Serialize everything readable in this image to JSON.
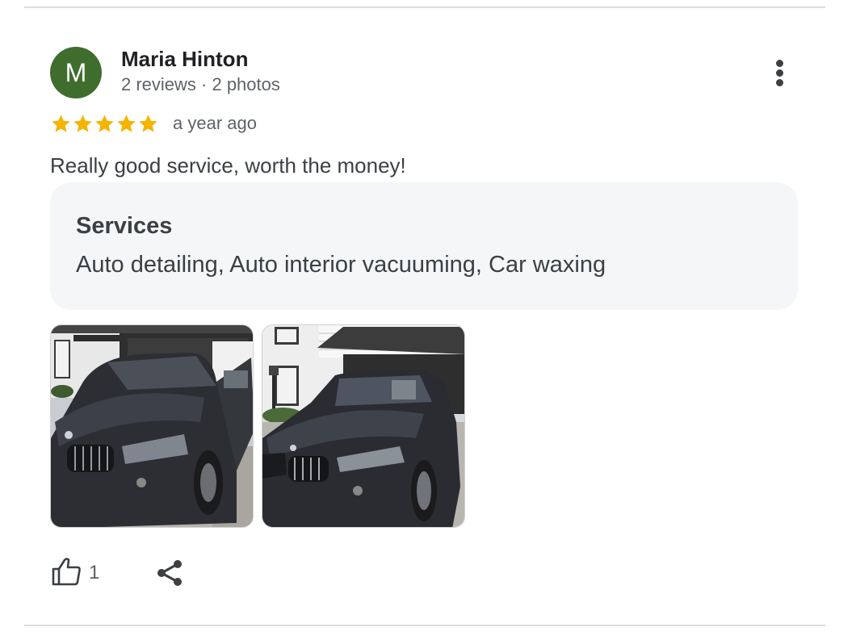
{
  "review": {
    "author": {
      "initial": "M",
      "name": "Maria Hinton",
      "meta": "2 reviews · 2 photos",
      "avatar_color": "#3f6d2e"
    },
    "rating": 5,
    "rating_max": 5,
    "star_color": "#f4b400",
    "time": "a year ago",
    "text": "Really good service, worth the money!",
    "services": {
      "title": "Services",
      "list": "Auto detailing, Auto interior vacuuming, Car waxing"
    },
    "photos": [
      {
        "name": "review-photo-1"
      },
      {
        "name": "review-photo-2"
      }
    ],
    "actions": {
      "like_icon": "thumb-up-icon",
      "like_count": "1",
      "share_icon": "share-icon",
      "more_icon": "more-vert-icon"
    }
  }
}
